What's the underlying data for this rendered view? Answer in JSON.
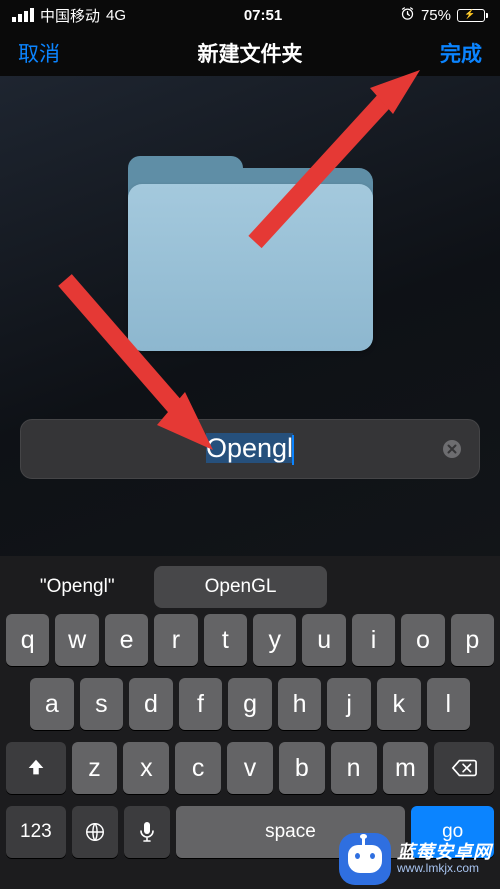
{
  "statusbar": {
    "carrier": "中国移动",
    "network": "4G",
    "time": "07:51",
    "alarm_icon": "⏰",
    "battery_pct": "75%"
  },
  "nav": {
    "cancel": "取消",
    "title": "新建文件夹",
    "done": "完成"
  },
  "folder": {
    "name": "Opengl"
  },
  "suggestions": {
    "quoted": "\"Opengl\"",
    "first": "OpenGL"
  },
  "keys": {
    "row1": [
      "q",
      "w",
      "e",
      "r",
      "t",
      "y",
      "u",
      "i",
      "o",
      "p"
    ],
    "row2": [
      "a",
      "s",
      "d",
      "f",
      "g",
      "h",
      "j",
      "k",
      "l"
    ],
    "row3": [
      "z",
      "x",
      "c",
      "v",
      "b",
      "n",
      "m"
    ],
    "shift": "⇧",
    "delete": "⌫",
    "num": "123",
    "globe": "🌐",
    "mic": "🎤",
    "space": "space",
    "go": "go"
  },
  "watermark": {
    "title": "蓝莓安卓网",
    "url": "www.lmkjx.com"
  }
}
